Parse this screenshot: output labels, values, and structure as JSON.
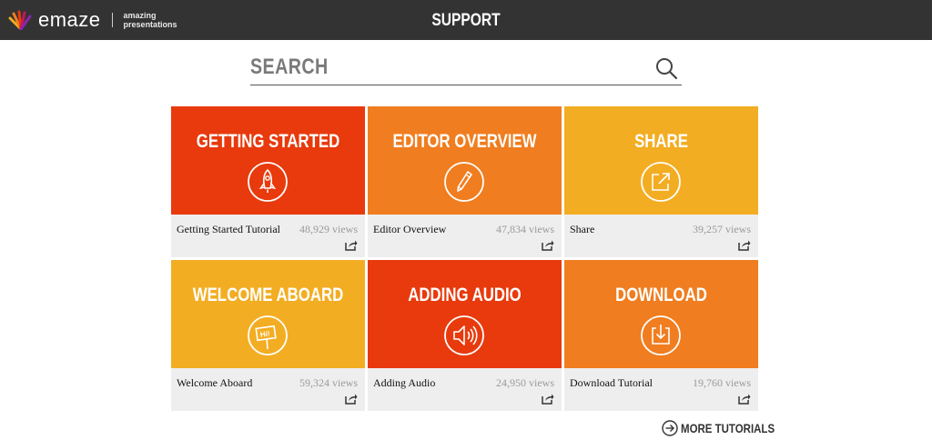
{
  "header": {
    "logo_text": "emaze",
    "tagline": "amazing presentations",
    "title": "SUPPORT",
    "bg_color": "#333333"
  },
  "search": {
    "placeholder": "SEARCH",
    "value": "",
    "icon": "search-icon"
  },
  "tutorials": [
    {
      "title": "GETTING STARTED",
      "name": "Getting Started Tutorial",
      "views": "48,929 views",
      "color": "#e83a0d",
      "icon": "rocket-icon"
    },
    {
      "title": "EDITOR OVERVIEW",
      "name": "Editor Overview",
      "views": "47,834 views",
      "color": "#f07d1f",
      "icon": "pencil-icon"
    },
    {
      "title": "SHARE",
      "name": "Share",
      "views": "39,257 views",
      "color": "#f3ad22",
      "icon": "share-arrow-icon"
    },
    {
      "title": "WELCOME ABOARD",
      "name": "Welcome Aboard",
      "views": "59,324 views",
      "color": "#f3ad22",
      "icon": "sign-icon",
      "sign_text": "Hi!"
    },
    {
      "title": "ADDING AUDIO",
      "name": "Adding Audio",
      "views": "24,950 views",
      "color": "#e83a0d",
      "icon": "speaker-icon"
    },
    {
      "title": "DOWNLOAD",
      "name": "Download Tutorial",
      "views": "19,760 views",
      "color": "#f07d1f",
      "icon": "download-icon"
    }
  ],
  "more": {
    "label": "MORE TUTORIALS",
    "icon": "arrow-circle-icon"
  },
  "colors": {
    "card_footer": "#eeeeee",
    "views_text": "#9a9a9a"
  }
}
